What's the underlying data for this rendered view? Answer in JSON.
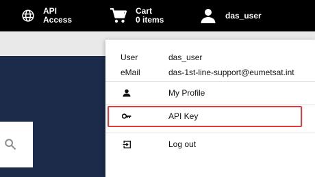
{
  "header": {
    "api_access": {
      "icon": "globe-icon",
      "line1": "API",
      "line2": "Access"
    },
    "cart": {
      "icon": "cart-icon",
      "line1": "Cart",
      "line2": "0 items"
    },
    "user": {
      "icon": "person-icon",
      "name": "das_user"
    }
  },
  "search": {
    "icon": "search-icon"
  },
  "user_menu": {
    "info": [
      {
        "label": "User",
        "value": "das_user"
      },
      {
        "label": "eMail",
        "value": "das-1st-line-support@eumetsat.int"
      }
    ],
    "items": [
      {
        "label": "My Profile",
        "icon": "person-icon"
      },
      {
        "label": "API Key",
        "icon": "key-icon"
      },
      {
        "label": "Log out",
        "icon": "logout-icon"
      }
    ]
  },
  "colors": {
    "topbar": "#000000",
    "background": "#1c2b4a",
    "highlight": "#e5383b"
  }
}
